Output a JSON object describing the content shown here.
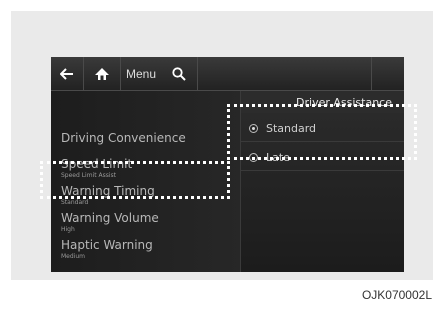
{
  "toolbar": {
    "back_icon": "arrow-left-icon",
    "home_icon": "home-icon",
    "menu_label": "Menu",
    "search_icon": "search-icon"
  },
  "header": {
    "title": "Driver Assistance"
  },
  "sidebar": {
    "items": [
      {
        "label": "Driving Convenience",
        "sub": ""
      },
      {
        "label": "Speed Limit",
        "sub": "Speed Limit Assist"
      },
      {
        "label": "Warning Timing",
        "sub": "Standard"
      },
      {
        "label": "Warning Volume",
        "sub": "High"
      },
      {
        "label": "Haptic Warning",
        "sub": "Medium"
      }
    ]
  },
  "options": [
    {
      "label": "Standard",
      "selected": true
    },
    {
      "label": "Late",
      "selected": false
    }
  ],
  "figure_ref": "OJK070002L",
  "colors": {
    "screen_bg": "#1a1a1a",
    "text": "#b8b8b8",
    "highlight": "#ffffff"
  }
}
